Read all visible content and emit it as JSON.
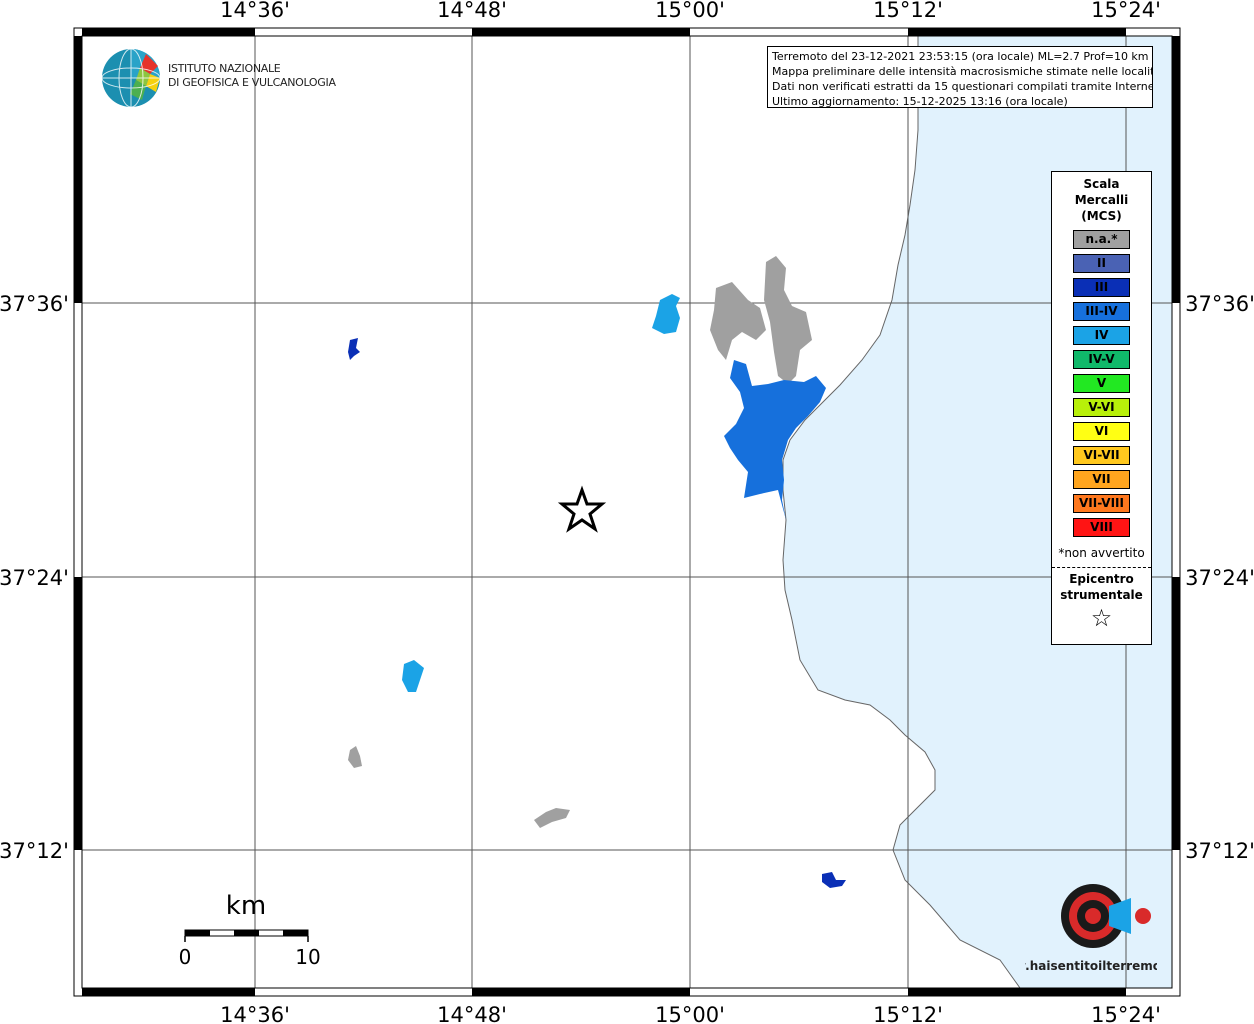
{
  "header": {
    "logo": {
      "line1": "ISTITUTO NAZIONALE",
      "line2": "DI GEOFISICA E VULCANOLOGIA"
    }
  },
  "info": {
    "line1": "Terremoto del 23-12-2021 23:53:15 (ora locale) ML=2.7 Prof=10 km",
    "line2": "Mappa preliminare delle intensità macrosismiche stimate nelle località",
    "line3": "Dati non verificati estratti da 15 questionari compilati tramite Internet.",
    "line4": "Ultimo aggiornamento: 15-12-2025 13:16 (ora locale)"
  },
  "axes": {
    "lon_labels": [
      "14°36'",
      "14°48'",
      "15°00'",
      "15°12'",
      "15°24'"
    ],
    "lat_labels": [
      "37°36'",
      "37°24'",
      "37°12'"
    ]
  },
  "legend": {
    "title": [
      "Scala",
      "Mercalli",
      "(MCS)"
    ],
    "items": [
      {
        "label": "n.a.*",
        "color": "#a0a0a0"
      },
      {
        "label": "II",
        "color": "#4a62b4"
      },
      {
        "label": "III",
        "color": "#0a2fb6"
      },
      {
        "label": "III-IV",
        "color": "#1670dc"
      },
      {
        "label": "IV",
        "color": "#1ba3e6"
      },
      {
        "label": "IV-V",
        "color": "#10b96a"
      },
      {
        "label": "V",
        "color": "#22e822"
      },
      {
        "label": "V-VI",
        "color": "#b8f00a"
      },
      {
        "label": "VI",
        "color": "#ffff14"
      },
      {
        "label": "VI-VII",
        "color": "#ffc81e"
      },
      {
        "label": "VII",
        "color": "#ffa51e"
      },
      {
        "label": "VII-VIII",
        "color": "#ff781e"
      },
      {
        "label": "VIII",
        "color": "#ff1414"
      }
    ],
    "note": "*non avvertito",
    "epicenter": [
      "Epicentro",
      "strumentale"
    ],
    "epicenter_symbol": "☆"
  },
  "scalebar": {
    "unit": "km",
    "min": "0",
    "max": "10"
  },
  "places": [
    {
      "name": "place-north-west",
      "intensity": "III",
      "color": "#0a2fb6"
    },
    {
      "name": "place-north",
      "intensity": "IV",
      "color": "#1ba3e6"
    },
    {
      "name": "place-grey-north-a",
      "intensity": "n.a.*",
      "color": "#a0a0a0"
    },
    {
      "name": "place-grey-north-b",
      "intensity": "n.a.*",
      "color": "#a0a0a0"
    },
    {
      "name": "place-city",
      "intensity": "III-IV",
      "color": "#1670dc"
    },
    {
      "name": "place-south-west",
      "intensity": "IV",
      "color": "#1ba3e6"
    },
    {
      "name": "place-grey-south-a",
      "intensity": "n.a.*",
      "color": "#a0a0a0"
    },
    {
      "name": "place-grey-south-b",
      "intensity": "n.a.*",
      "color": "#a0a0a0"
    },
    {
      "name": "place-south-east",
      "intensity": "III",
      "color": "#0a2fb6"
    }
  ],
  "watermark": {
    "text": "www.haisentitoilterremoto.it"
  },
  "colors": {
    "sea": "#e1f2fd",
    "frame": "#000000",
    "grid": "#555555"
  }
}
